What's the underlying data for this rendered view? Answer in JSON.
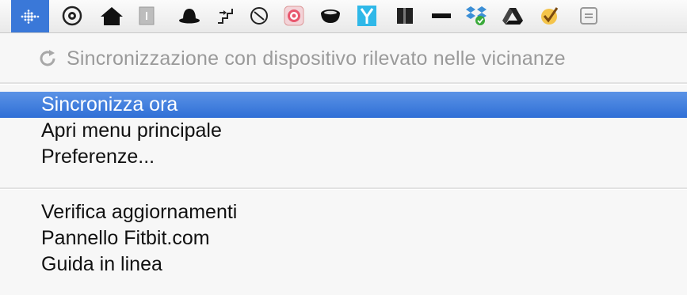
{
  "menubar": {
    "icons": [
      "fitbit-icon",
      "target-icon",
      "home-icon",
      "document-icon",
      "bowler-hat-icon",
      "stairs-icon",
      "clock-icon",
      "bullseye-icon",
      "coffee-cup-icon",
      "y-logo-icon",
      "book-icon",
      "battery-icon",
      "dropbox-icon",
      "drive-icon",
      "checkmark-icon",
      "extra-icon"
    ],
    "active_icon": "fitbit-icon"
  },
  "menu": {
    "status": {
      "icon": "sync-icon",
      "text": "Sincronizzazione con dispositivo rilevato nelle vicinanze"
    },
    "group1": [
      "Sincronizza ora",
      "Apri menu principale",
      "Preferenze..."
    ],
    "group2": [
      "Verifica aggiornamenti",
      "Pannello Fitbit.com",
      "Guida in linea"
    ],
    "highlighted": "Sincronizza ora"
  },
  "colors": {
    "highlight": "#3a78d8",
    "status_text": "#9a9a9a",
    "menu_text": "#111111"
  }
}
